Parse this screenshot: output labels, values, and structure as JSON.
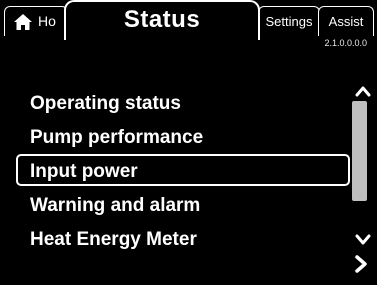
{
  "tabs": {
    "home_label": "Ho",
    "status_label": "Status",
    "settings_label": "Settings",
    "assist_label": "Assist"
  },
  "version": "2.1.0.0.0.0",
  "menu": {
    "items": [
      {
        "label": "Operating status"
      },
      {
        "label": "Pump performance"
      },
      {
        "label": "Input power"
      },
      {
        "label": "Warning and alarm"
      },
      {
        "label": "Heat Energy Meter"
      }
    ],
    "selected_index": 2
  },
  "scrollbar": {
    "position_fraction": 0.0,
    "visible_fraction": 0.77
  },
  "icons": {
    "home": "house-icon",
    "scroll_up": "chevron-up-icon",
    "scroll_down": "chevron-down-icon",
    "next": "chevron-right-icon"
  }
}
